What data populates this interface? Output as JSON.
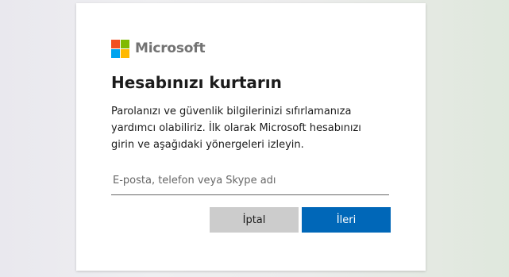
{
  "brand": {
    "name": "Microsoft",
    "logo_colors": [
      "#f25022",
      "#7fba00",
      "#00a4ef",
      "#ffb900"
    ]
  },
  "dialog": {
    "title": "Hesabınızı kurtarın",
    "description": "Parolanızı ve güvenlik bilgilerinizi sıfırlamanıza yardımcı olabiliriz. İlk olarak Microsoft hesabınızı girin ve aşağıdaki yönergeleri izleyin.",
    "account_input": {
      "value": "",
      "placeholder": "E-posta, telefon veya Skype adı"
    },
    "cancel_label": "İptal",
    "next_label": "İleri"
  },
  "colors": {
    "primary_button": "#0067b8",
    "secondary_button": "#cccccc"
  }
}
